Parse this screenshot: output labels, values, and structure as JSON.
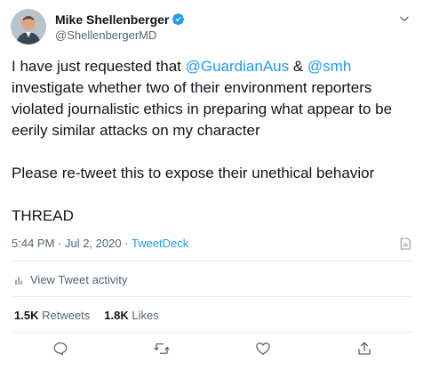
{
  "author": {
    "display_name": "Mike Shellenberger",
    "handle": "@ShellenbergerMD"
  },
  "tweet": {
    "line1_pre": "I have just requested that ",
    "mention1": "@GuardianAus",
    "line1_mid": " & ",
    "mention2": "@smh",
    "line1_post": " investigate whether two of their environment reporters violated journalistic ethics in preparing what appear to be eerily similar attacks on my character",
    "para2": "Please re-tweet this to expose their unethical behavior",
    "para3": "THREAD"
  },
  "meta": {
    "timestamp": "5:44 PM · Jul 2, 2020",
    "separator": " · ",
    "source": "TweetDeck"
  },
  "activity": {
    "label": "View Tweet activity"
  },
  "stats": {
    "retweets_count": "1.5K",
    "retweets_label": "Retweets",
    "likes_count": "1.8K",
    "likes_label": "Likes"
  },
  "colors": {
    "accent": "#1d9bf0",
    "text": "#0f1419",
    "secondary": "#536471",
    "divider": "#e6ecf0"
  },
  "icons": {
    "verified": "verified-badge-icon",
    "more": "chevron-down-icon",
    "metrics": "tweet-analytics-icon",
    "activity": "bar-chart-icon",
    "reply": "reply-icon",
    "retweet": "retweet-icon",
    "like": "heart-icon",
    "share": "share-icon"
  }
}
